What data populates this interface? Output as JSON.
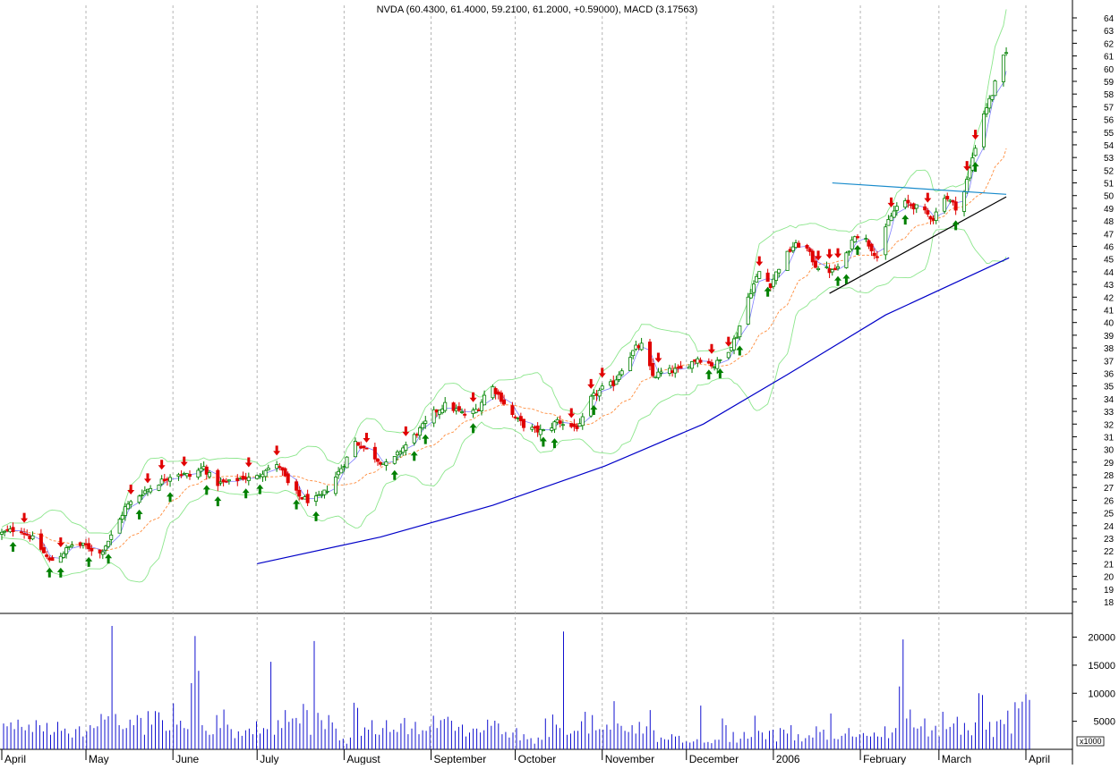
{
  "header": {
    "title": "NVDA (60.4300, 61.4000, 59.2100, 61.2000, +0.59000), MACD (3.17563)"
  },
  "colors": {
    "up": "#008000",
    "down": "#e00000",
    "trend_main": "#0000c8",
    "trend_resistance": "#1a8ccc",
    "trend_support": "#000000",
    "band": "#8ce68c",
    "ma_fast": "#8080ff",
    "ma_slow": "#ff8c3c",
    "volume": "#1010d0",
    "grid": "#b4b4b4"
  },
  "chart_data": [
    {
      "type": "candlestick",
      "name": "price",
      "y_axis": {
        "min": 18,
        "max": 64,
        "step": 1,
        "side": "right"
      },
      "x_axis": {
        "labels": [
          "April",
          "May",
          "June",
          "July",
          "August",
          "September",
          "October",
          "November",
          "December",
          "2006",
          "February",
          "March",
          "April"
        ],
        "label_days": [
          0,
          30,
          61,
          91,
          122,
          153,
          183,
          214,
          244,
          275,
          306,
          334,
          365
        ]
      },
      "grid": true,
      "close_path": [
        [
          0,
          23.4
        ],
        [
          6,
          23.8
        ],
        [
          12,
          22.8
        ],
        [
          17,
          21.2
        ],
        [
          20,
          21.5
        ],
        [
          25,
          22.5
        ],
        [
          30,
          22.4
        ],
        [
          35,
          21.8
        ],
        [
          40,
          23.5
        ],
        [
          44,
          25.4
        ],
        [
          50,
          26.6
        ],
        [
          56,
          27.4
        ],
        [
          62,
          28.2
        ],
        [
          67,
          27.9
        ],
        [
          72,
          28.6
        ],
        [
          76,
          27.3
        ],
        [
          81,
          27.4
        ],
        [
          86,
          27.8
        ],
        [
          90,
          27.6
        ],
        [
          94,
          28.5
        ],
        [
          99,
          28.7
        ],
        [
          102,
          27.3
        ],
        [
          106,
          26.3
        ],
        [
          110,
          25.9
        ],
        [
          114,
          26.3
        ],
        [
          118,
          27.5
        ],
        [
          122,
          28.9
        ],
        [
          126,
          30.6
        ],
        [
          130,
          30.0
        ],
        [
          134,
          29.2
        ],
        [
          138,
          28.7
        ],
        [
          142,
          29.9
        ],
        [
          146,
          30.8
        ],
        [
          150,
          31.8
        ],
        [
          154,
          32.9
        ],
        [
          158,
          33.5
        ],
        [
          162,
          33.1
        ],
        [
          166,
          32.6
        ],
        [
          170,
          33.3
        ],
        [
          174,
          35.2
        ],
        [
          178,
          34.0
        ],
        [
          182,
          32.7
        ],
        [
          186,
          31.9
        ],
        [
          190,
          31.5
        ],
        [
          194,
          31.4
        ],
        [
          198,
          32.3
        ],
        [
          202,
          31.8
        ],
        [
          206,
          31.8
        ],
        [
          210,
          34.0
        ],
        [
          214,
          34.8
        ],
        [
          218,
          35.2
        ],
        [
          222,
          36.8
        ],
        [
          226,
          38.0
        ],
        [
          228,
          38.2
        ],
        [
          232,
          35.8
        ],
        [
          236,
          36.1
        ],
        [
          242,
          36.3
        ],
        [
          248,
          37.2
        ],
        [
          254,
          36.6
        ],
        [
          258,
          37.5
        ],
        [
          262,
          39.0
        ],
        [
          266,
          42.0
        ],
        [
          270,
          44.0
        ],
        [
          274,
          43.0
        ],
        [
          278,
          44.8
        ],
        [
          282,
          46.0
        ],
        [
          286,
          46.2
        ],
        [
          290,
          44.5
        ],
        [
          296,
          44.0
        ],
        [
          300,
          44.7
        ],
        [
          304,
          47.0
        ],
        [
          308,
          46.5
        ],
        [
          312,
          45.2
        ],
        [
          316,
          48.0
        ],
        [
          320,
          49.5
        ],
        [
          324,
          49.3
        ],
        [
          328,
          48.8
        ],
        [
          332,
          48.2
        ],
        [
          336,
          50.0
        ],
        [
          340,
          49.1
        ],
        [
          343,
          50.3
        ],
        [
          346,
          53.0
        ],
        [
          350,
          56.5
        ],
        [
          353,
          58.0
        ],
        [
          356,
          60.5
        ],
        [
          358,
          61.2
        ]
      ],
      "volume": [
        4600,
        4100,
        4800,
        3600,
        5300,
        4000,
        3400,
        4400,
        3100,
        5200,
        4300,
        3200,
        4700,
        2600,
        3100,
        4900,
        3300,
        3700,
        2800,
        2100,
        3600,
        4100,
        2300,
        3200,
        4300,
        3800,
        4100,
        6300,
        5300,
        5900,
        22000,
        6300,
        4300,
        3600,
        3800,
        5300,
        4300,
        6100,
        5600,
        2600,
        6800,
        4400,
        6800,
        6600,
        5200,
        3300,
        3400,
        8200,
        4400,
        5100,
        3800,
        3600,
        11800,
        20200,
        14000,
        4300,
        3300,
        2600,
        2700,
        6100,
        3800,
        7100,
        4400,
        3600,
        2000,
        3200,
        2400,
        3400,
        3700,
        2700,
        5000,
        2800,
        3800,
        3600,
        15600,
        2600,
        5200,
        3800,
        7000,
        4900,
        5500,
        5600,
        4600,
        8100,
        7000,
        2600,
        19300,
        6500,
        5200,
        3600,
        6100,
        4800,
        3700,
        1600,
        1900,
        1000,
        2100,
        8300,
        7400,
        2400,
        3900,
        3500,
        5200,
        2700,
        2600,
        3800,
        5200,
        3100,
        3500,
        3100,
        4600,
        5600,
        2700,
        3700,
        4900,
        2700,
        3400,
        3300,
        4100,
        6000,
        3800,
        5200,
        5400,
        5800,
        5100,
        3300,
        4000,
        4400,
        2300,
        3000,
        3700,
        3700,
        3000,
        3400,
        5300,
        4200,
        5100,
        4600,
        2700,
        3100,
        2100,
        3000,
        3800,
        1600,
        2700,
        1800,
        2000,
        1000,
        2100,
        1700,
        5500,
        2200,
        6200,
        4400,
        3800,
        21000,
        2600,
        2800,
        3300,
        3300,
        5000,
        6700,
        2800,
        6100,
        3400,
        3600,
        3500,
        4400,
        3500,
        8600,
        4600,
        4200,
        3300,
        3100,
        4300,
        2800,
        4900,
        2800,
        4100,
        7000,
        3400,
        1300,
        2100,
        1800,
        1700,
        2700,
        2300,
        2400,
        1200,
        1400,
        1200,
        1400,
        1800,
        7800,
        1200,
        1300,
        1100,
        1700,
        1700,
        5500,
        4300,
        1300,
        3100,
        1200,
        1900,
        3100,
        1900,
        2200,
        6000,
        3300,
        3000,
        1800,
        3300,
        3500,
        1400,
        3800,
        3500,
        2800,
        4300,
        1600,
        2700,
        1400,
        2000,
        2500,
        2100,
        4100,
        3100,
        3500,
        1700,
        6400,
        1900,
        1800,
        2400,
        2800,
        3800,
        2300,
        2200,
        2700,
        2900,
        2400,
        2300,
        3000,
        2300,
        2200,
        4100,
        2000,
        3000,
        3800,
        11200,
        19600,
        5500,
        7100,
        3900,
        3700,
        4100,
        5500,
        2300,
        3400,
        4200,
        2300,
        6700,
        3600,
        4000,
        4600,
        5800,
        2600,
        4700,
        3400,
        2500,
        4800,
        10000,
        9700,
        3500,
        4900,
        2200,
        5000,
        5300,
        4500,
        6900,
        2800,
        8400,
        7300,
        8500,
        9800,
        8800
      ],
      "annotations": {
        "support_curve": [
          [
            91,
            21.0
          ],
          [
            135,
            23.1
          ],
          [
            175,
            25.6
          ],
          [
            215,
            28.7
          ],
          [
            250,
            32.0
          ],
          [
            280,
            35.9
          ],
          [
            315,
            40.6
          ],
          [
            359,
            45.1
          ]
        ],
        "resistance_line": [
          [
            296,
            51.0
          ],
          [
            358,
            50.1
          ]
        ],
        "support_line": [
          [
            295,
            42.3
          ],
          [
            358,
            49.9
          ]
        ],
        "buy_signals": [
          5,
          17,
          20,
          31,
          38,
          48,
          60,
          73,
          77,
          87,
          92,
          104,
          112,
          139,
          146,
          151,
          168,
          193,
          197,
          211,
          251,
          256,
          263,
          273,
          298,
          301,
          306,
          321,
          340,
          347
        ],
        "sell_signals": [
          8,
          21,
          46,
          52,
          57,
          65,
          88,
          98,
          131,
          145,
          168,
          202,
          209,
          215,
          234,
          253,
          258,
          270,
          291,
          295,
          299,
          317,
          330,
          344,
          348
        ]
      }
    },
    {
      "type": "bar",
      "name": "volume",
      "y_axis": {
        "min": 0,
        "max": 22000,
        "ticks": [
          5000,
          10000,
          15000,
          20000
        ],
        "side": "right"
      },
      "unit_label": "x1000"
    }
  ]
}
